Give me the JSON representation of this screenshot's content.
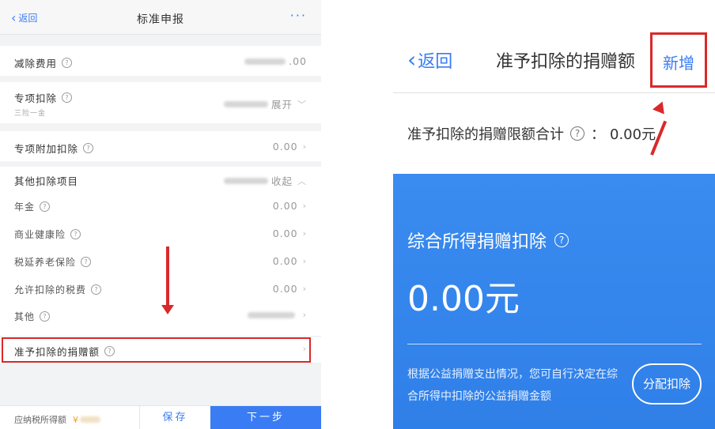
{
  "left": {
    "nav": {
      "back_label": "返回",
      "title": "标准申报",
      "more": "···"
    },
    "rows": {
      "reduction": {
        "label": "减除费用",
        "value": ".00"
      },
      "special": {
        "label": "专项扣除",
        "sub": "三险一金",
        "value_suffix": "展开"
      },
      "special_additional": {
        "label": "专项附加扣除",
        "value": "0.00"
      },
      "other_items": {
        "label": "其他扣除项目",
        "value_suffix": "收起"
      },
      "annuity": {
        "label": "年金",
        "value": "0.00"
      },
      "health_insurance": {
        "label": "商业健康险",
        "value": "0.00"
      },
      "pension": {
        "label": "税延养老保险",
        "value": "0.00"
      },
      "allowed_tax": {
        "label": "允许扣除的税费",
        "value": "0.00"
      },
      "other": {
        "label": "其他"
      },
      "donation": {
        "label": "准予扣除的捐赠额"
      }
    },
    "bottom": {
      "tax_label": "应纳税所得额",
      "yen": "¥",
      "save_label": "保存",
      "next_label": "下一步"
    }
  },
  "right": {
    "nav": {
      "back_label": "返回",
      "title": "准予扣除的捐赠额",
      "add_label": "新增"
    },
    "limit": {
      "label": "准予扣除的捐赠限额合计",
      "colon": "：",
      "value": "0.00元"
    },
    "card": {
      "title": "综合所得捐赠扣除",
      "amount": "0.00元",
      "desc": "根据公益捐赠支出情况，您可自行决定在综合所得中扣除的公益捐赠金额",
      "allocate_label": "分配扣除"
    }
  },
  "colors": {
    "accent": "#3a7cf4",
    "highlight": "#d9292a",
    "card_blue": "#3a8cf0"
  },
  "icons": [
    "chevron-left-icon",
    "more-icon",
    "help-icon",
    "chevron-right-icon",
    "chevron-down-icon",
    "chevron-up-icon",
    "red-arrow-icon"
  ]
}
